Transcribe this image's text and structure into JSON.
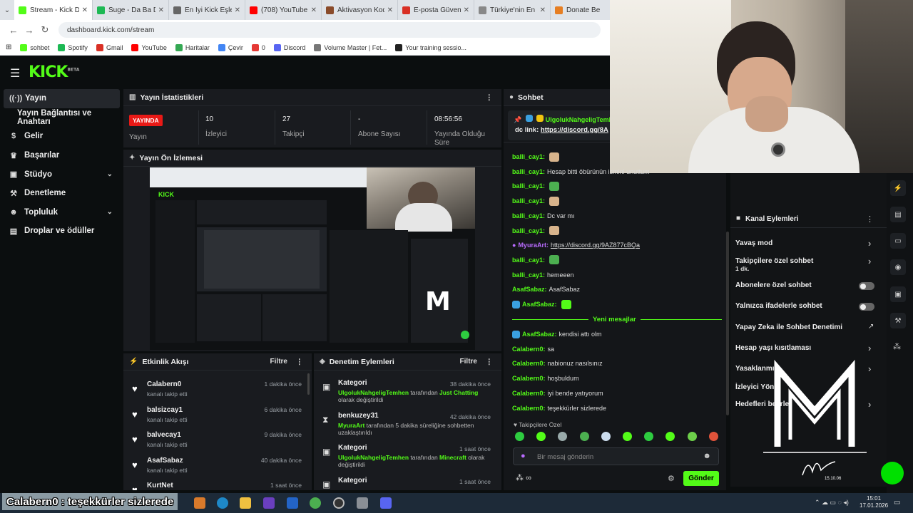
{
  "browser": {
    "tabs": [
      {
        "title": "Stream - Kick Dash",
        "color": "#53fc18",
        "active": true
      },
      {
        "title": "Suge - Da Ba Dee",
        "color": "#1db954"
      },
      {
        "title": "En İyi Kick Eşleşi",
        "color": "#666666"
      },
      {
        "title": "(708) YouTube",
        "color": "#ff0000"
      },
      {
        "title": "Aktivasyon Kodu",
        "color": "#8a4b2a"
      },
      {
        "title": "E-posta Güvenli G",
        "color": "#d93025"
      },
      {
        "title": "Türkiye'nin En Dev",
        "color": "#888888"
      },
      {
        "title": "Donate Be",
        "color": "#e67e22"
      }
    ],
    "url": "dashboard.kick.com/stream",
    "bookmarks": [
      {
        "label": "sohbet",
        "color": "#53fc18"
      },
      {
        "label": "Spotify",
        "color": "#1db954"
      },
      {
        "label": "Gmail",
        "color": "#d93025"
      },
      {
        "label": "YouTube",
        "color": "#ff0000"
      },
      {
        "label": "Haritalar",
        "color": "#34a853"
      },
      {
        "label": "Çevir",
        "color": "#4285f4"
      },
      {
        "label": "0",
        "color": "#e53935"
      },
      {
        "label": "Discord",
        "color": "#5865f2"
      },
      {
        "label": "Volume Master | Fet...",
        "color": "#777777"
      },
      {
        "label": "Your training sessio...",
        "color": "#222222"
      }
    ]
  },
  "kick": {
    "logo": "KICK",
    "logo_sup": "BETA",
    "sidebar": [
      {
        "label": "Yayın",
        "icon": "broadcast-icon",
        "glyph": "((·))",
        "active": true
      },
      {
        "label": "Yayın Bağlantısı ve Anahtarı",
        "icon": "",
        "glyph": ""
      },
      {
        "label": "Gelir",
        "icon": "dollar-icon",
        "glyph": "$"
      },
      {
        "label": "Başarılar",
        "icon": "trophy-icon",
        "glyph": "♛"
      },
      {
        "label": "Stüdyo",
        "icon": "studio-icon",
        "glyph": "▣",
        "chevron": true
      },
      {
        "label": "Denetleme",
        "icon": "wrench-icon",
        "glyph": "⚒"
      },
      {
        "label": "Topluluk",
        "icon": "community-icon",
        "glyph": "☻",
        "chevron": true
      },
      {
        "label": "Droplar ve ödüller",
        "icon": "gift-icon",
        "glyph": "▤"
      }
    ],
    "stats": {
      "title": "Yayın İstatistikleri",
      "live_badge": "YAYINDA",
      "live_label": "Yayın",
      "viewers_value": "10",
      "viewers_label": "İzleyici",
      "followers_value": "27",
      "followers_label": "Takipçi",
      "subs_value": "-",
      "subs_label": "Abone Sayısı",
      "uptime_value": "08:56:56",
      "uptime_label": "Yayında Olduğu Süre"
    },
    "preview": {
      "title": "Yayın Ön İzlemesi"
    },
    "activity": {
      "title": "Etkinlik Akışı",
      "filter": "Filtre",
      "items": [
        {
          "name": "Calabern0",
          "sub": "kanalı takip etti",
          "time": "1 dakika önce"
        },
        {
          "name": "balsizcay1",
          "sub": "kanalı takip etti",
          "time": "6 dakika önce"
        },
        {
          "name": "balvecay1",
          "sub": "kanalı takip etti",
          "time": "9 dakika önce"
        },
        {
          "name": "AsafSabaz",
          "sub": "kanalı takip etti",
          "time": "40 dakika önce"
        },
        {
          "name": "KurtNet",
          "sub": "",
          "time": "1 saat önce"
        }
      ]
    },
    "moderation": {
      "title": "Denetim Eylemleri",
      "filter": "Filtre",
      "items": [
        {
          "title": "Kategori",
          "time": "38 dakika önce",
          "actor": "UlgolukNahgeligTemhen",
          "mid": " tarafından ",
          "target": "Just Chatting",
          "end": " olarak değiştirildi"
        },
        {
          "title": "benkuzey31",
          "time": "42 dakika önce",
          "actor": "MyuraArt",
          "mid": " tarafından 5 dakika süreliğine sohbetten",
          "target": "",
          "end": " uzaklaştırıldı"
        },
        {
          "title": "Kategori",
          "time": "1 saat önce",
          "actor": "UlgolukNahgeligTemhen",
          "mid": " tarafından ",
          "target": "Minecraft",
          "end": " olarak değiştirildi"
        },
        {
          "title": "Kategori",
          "time": "1 saat önce",
          "actor": "",
          "mid": "",
          "target": "",
          "end": ""
        }
      ]
    },
    "chat": {
      "title": "Sohbet",
      "pinned_user": "UlgolukNahgeligTemhen",
      "pinned_text": "dc link: ",
      "pinned_link": "https://discord.gg/8A",
      "messages": [
        {
          "user": "balli_cay1:",
          "text": "",
          "emote": "#d8b48c"
        },
        {
          "user": "balli_cay1:",
          "text": "Hesap bitti öbürünün ismini unuttum",
          "emote": ""
        },
        {
          "user": "balli_cay1:",
          "text": "",
          "emote": "#4caf50"
        },
        {
          "user": "balli_cay1:",
          "text": "",
          "emote": "#d8b48c"
        },
        {
          "user": "balli_cay1:",
          "text": "Dc var mı",
          "emote": ""
        },
        {
          "user": "balli_cay1:",
          "text": "",
          "emote": "#d8b48c"
        },
        {
          "user": "MyuraArt:",
          "text": "https://discord.gg/9AZ877cBQa",
          "emote": "",
          "purple": true
        },
        {
          "user": "balli_cay1:",
          "text": "",
          "emote": "#4caf50"
        },
        {
          "user": "balli_cay1:",
          "text": "hemeeen",
          "emote": ""
        },
        {
          "user": "AsafSabaz:",
          "text": "AsafSabaz",
          "emote": ""
        },
        {
          "user": "AsafSabaz:",
          "text": "",
          "emote": "#53fc18"
        }
      ],
      "new_divider": "Yeni mesajlar",
      "new_messages": [
        {
          "user": "AsafSabaz:",
          "text": "kendisi attı olm"
        },
        {
          "user": "Calabern0:",
          "text": "sa"
        },
        {
          "user": "Calabern0:",
          "text": "nabionuz nasılsınız"
        },
        {
          "user": "Calabern0:",
          "text": "hoşbuldum"
        },
        {
          "user": "Calabern0:",
          "text": "iyi bende yatıyorum"
        },
        {
          "user": "Calabern0:",
          "text": "teşekkürler sizlerede"
        }
      ],
      "followers_only": "Takipçilere Özel",
      "input_placeholder": "Bir mesaj gönderin",
      "send_label": "Gönder",
      "points": "∞"
    },
    "channel_actions": {
      "title": "Kanal Eylemleri",
      "items": [
        {
          "label": "Yavaş mod",
          "control": "arrow"
        },
        {
          "label": "Takipçilere özel sohbet",
          "sub": "1 dk.",
          "control": "arrow"
        },
        {
          "label": "Abonelere özel sohbet",
          "control": "toggle"
        },
        {
          "label": "Yalnızca ifadelerle sohbet",
          "control": "toggle"
        },
        {
          "label": "Yapay Zeka ile Sohbet Denetimi",
          "control": "external"
        },
        {
          "label": "Hesap yaşı kısıtlaması",
          "control": "arrow"
        },
        {
          "label": "Yasaklanmış",
          "control": "arrow"
        },
        {
          "label": "İzleyici Yönl",
          "control": ""
        },
        {
          "label": "Hedefleri belirle",
          "control": "arrow"
        }
      ]
    }
  },
  "overlay": {
    "caption": "Calabern0 : teşekkürler sizlerede",
    "watermark_letter": "M",
    "watermark_signature": "Murat",
    "watermark_date": "15.10.06"
  },
  "taskbar": {
    "time": "15:01",
    "date": "17.01.2026"
  }
}
